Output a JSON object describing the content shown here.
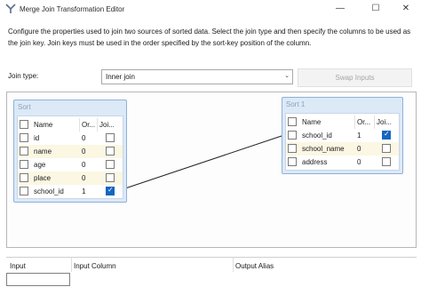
{
  "window": {
    "title": "Merge Join Transformation Editor",
    "min": "—",
    "max": "☐",
    "close": "✕"
  },
  "description": "Configure the properties used to join two sources of sorted data. Select the join type and then specify the columns to be used as the join key. Join keys must be used in the order specified by the sort-key position of the column.",
  "join_type": {
    "label": "Join type:",
    "value": "Inner join"
  },
  "swap_button": "Swap Inputs",
  "left_table": {
    "title": "Sort",
    "headers": {
      "name": "Name",
      "order": "Or...",
      "join": "Joi..."
    },
    "rows": [
      {
        "name": "id",
        "order": "0",
        "join": false
      },
      {
        "name": "name",
        "order": "0",
        "join": false
      },
      {
        "name": "age",
        "order": "0",
        "join": false
      },
      {
        "name": "place",
        "order": "0",
        "join": false
      },
      {
        "name": "school_id",
        "order": "1",
        "join": true
      }
    ]
  },
  "right_table": {
    "title": "Sort 1",
    "headers": {
      "name": "Name",
      "order": "Or...",
      "join": "Joi..."
    },
    "rows": [
      {
        "name": "school_id",
        "order": "1",
        "join": true
      },
      {
        "name": "school_name",
        "order": "0",
        "join": false
      },
      {
        "name": "address",
        "order": "0",
        "join": false
      }
    ]
  },
  "output_grid": {
    "columns": [
      "Input",
      "Input Column",
      "Output Alias"
    ]
  },
  "colors": {
    "table_bg": "#dce9f7",
    "alt_row": "#fbf7e3",
    "check": "#1565c0"
  }
}
